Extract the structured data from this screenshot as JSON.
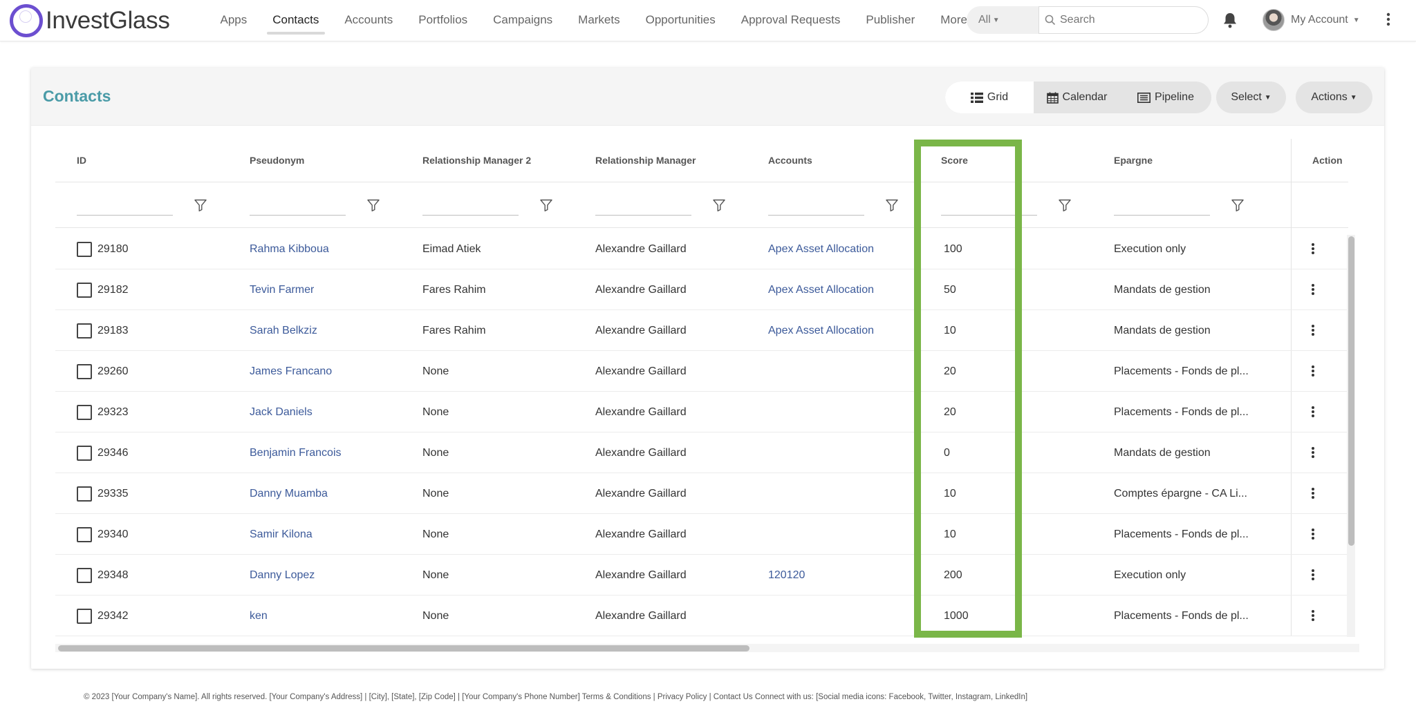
{
  "brand": {
    "name": "InvestGlass"
  },
  "nav": {
    "items": [
      {
        "label": "Apps",
        "active": false
      },
      {
        "label": "Contacts",
        "active": true
      },
      {
        "label": "Accounts",
        "active": false
      },
      {
        "label": "Portfolios",
        "active": false
      },
      {
        "label": "Campaigns",
        "active": false
      },
      {
        "label": "Markets",
        "active": false
      },
      {
        "label": "Opportunities",
        "active": false
      },
      {
        "label": "Approval Requests",
        "active": false
      },
      {
        "label": "Publisher",
        "active": false
      },
      {
        "label": "More",
        "active": false
      }
    ],
    "scope_label": "All",
    "search_placeholder": "Search",
    "account_label": "My Account"
  },
  "page": {
    "title": "Contacts",
    "views": {
      "grid": "Grid",
      "calendar": "Calendar",
      "pipeline": "Pipeline"
    },
    "select_label": "Select",
    "actions_label": "Actions"
  },
  "table": {
    "columns": {
      "id": "ID",
      "pseudonym": "Pseudonym",
      "rm2": "Relationship Manager 2",
      "rm": "Relationship Manager",
      "accounts": "Accounts",
      "score": "Score",
      "epargne": "Epargne",
      "action": "Action"
    },
    "rows": [
      {
        "id": "29180",
        "pseudonym": "Rahma Kibboua",
        "rm2": "Eimad Atiek",
        "rm": "Alexandre Gaillard",
        "accounts": "Apex Asset Allocation",
        "score": "100",
        "epargne": "Execution only"
      },
      {
        "id": "29182",
        "pseudonym": "Tevin Farmer",
        "rm2": "Fares Rahim",
        "rm": "Alexandre Gaillard",
        "accounts": "Apex Asset Allocation",
        "score": "50",
        "epargne": "Mandats de gestion"
      },
      {
        "id": "29183",
        "pseudonym": "Sarah Belkziz",
        "rm2": "Fares Rahim",
        "rm": "Alexandre Gaillard",
        "accounts": "Apex Asset Allocation",
        "score": "10",
        "epargne": "Mandats de gestion"
      },
      {
        "id": "29260",
        "pseudonym": "James Francano",
        "rm2": "None",
        "rm": "Alexandre Gaillard",
        "accounts": "",
        "score": "20",
        "epargne": "Placements - Fonds de pl..."
      },
      {
        "id": "29323",
        "pseudonym": "Jack Daniels",
        "rm2": "None",
        "rm": "Alexandre Gaillard",
        "accounts": "",
        "score": "20",
        "epargne": "Placements - Fonds de pl..."
      },
      {
        "id": "29346",
        "pseudonym": "Benjamin Francois",
        "rm2": "None",
        "rm": "Alexandre Gaillard",
        "accounts": "",
        "score": "0",
        "epargne": "Mandats de gestion"
      },
      {
        "id": "29335",
        "pseudonym": "Danny Muamba",
        "rm2": "None",
        "rm": "Alexandre Gaillard",
        "accounts": "",
        "score": "10",
        "epargne": "Comptes épargne - CA Li..."
      },
      {
        "id": "29340",
        "pseudonym": "Samir Kilona",
        "rm2": "None",
        "rm": "Alexandre Gaillard",
        "accounts": "",
        "score": "10",
        "epargne": "Placements - Fonds de pl..."
      },
      {
        "id": "29348",
        "pseudonym": "Danny Lopez",
        "rm2": "None",
        "rm": "Alexandre Gaillard",
        "accounts": "120120",
        "score": "200",
        "epargne": "Execution only"
      },
      {
        "id": "29342",
        "pseudonym": "ken",
        "rm2": "None",
        "rm": "Alexandre Gaillard",
        "accounts": "",
        "score": "1000",
        "epargne": "Placements - Fonds de pl..."
      }
    ]
  },
  "highlight": {
    "column": "score",
    "color": "#7ab648"
  },
  "footer": {
    "text": "© 2023 [Your Company's Name]. All rights reserved. [Your Company's Address] | [City], [State], [Zip Code] | [Your Company's Phone Number] Terms & Conditions | Privacy Policy | Contact Us Connect with us: [Social media icons: Facebook, Twitter, Instagram, LinkedIn]"
  }
}
